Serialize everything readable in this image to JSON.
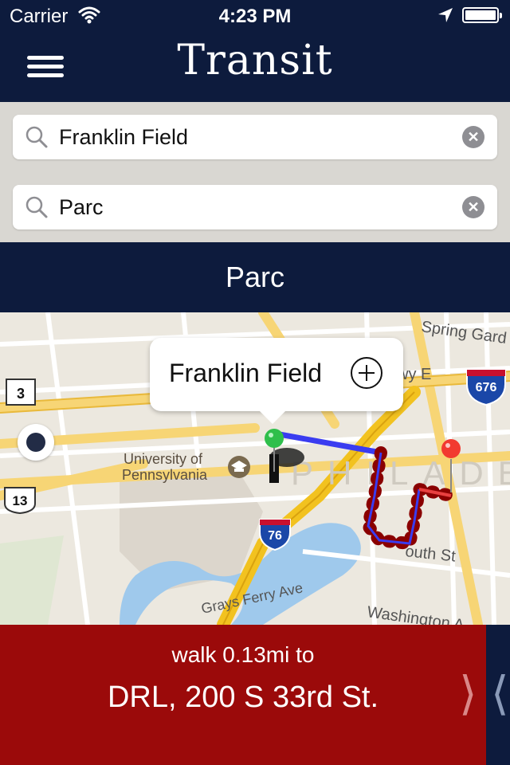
{
  "status_bar": {
    "carrier": "Carrier",
    "time": "4:23 PM"
  },
  "nav": {
    "title": "Transit"
  },
  "search": {
    "from_value": "Franklin Field",
    "to_value": "Parc"
  },
  "destination": {
    "name": "Parc"
  },
  "map": {
    "callout_label": "Franklin Field",
    "labels": {
      "spring_garden": "Spring Gard",
      "pkwy": "wy E",
      "university": "University of",
      "pennsylvania": "Pennsylvania",
      "philadelphia": "PHILADELPHIA",
      "south_st": "outh St",
      "grays_ferry": "Grays Ferry Ave",
      "washington": "Washington A"
    },
    "shields": {
      "i676": "676",
      "i76": "76",
      "us13": "13",
      "pa3": "3"
    }
  },
  "directions": {
    "line1": "walk 0.13mi to",
    "line2": "DRL, 200 S 33rd St."
  },
  "colors": {
    "navy": "#0d1b3d",
    "panel_red": "#9b0a0a",
    "route_blue": "#3a3cf0",
    "route_red": "#8a0000"
  }
}
